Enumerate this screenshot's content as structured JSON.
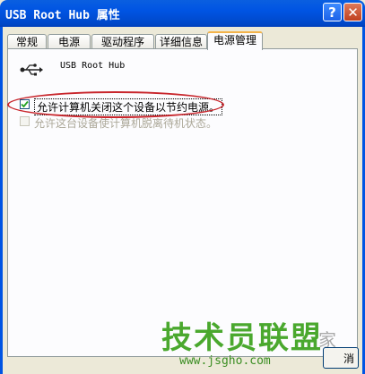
{
  "window": {
    "title": "USB Root Hub 属性"
  },
  "title_buttons": {
    "help": "?",
    "close": "✕"
  },
  "tabs": [
    {
      "label": "常规"
    },
    {
      "label": "电源"
    },
    {
      "label": "驱动程序"
    },
    {
      "label": "详细信息"
    },
    {
      "label": "电源管理"
    }
  ],
  "device": {
    "name": "USB Root Hub",
    "icon": "usb-icon"
  },
  "options": [
    {
      "label": "允许计算机关闭这个设备以节约电源。",
      "checked": true,
      "enabled": true
    },
    {
      "label": "允许这台设备使计算机脱离待机状态。",
      "checked": false,
      "enabled": false
    }
  ],
  "watermark": {
    "text": "技术员联盟",
    "url": "www.jsgho.com",
    "extra": "家"
  },
  "button_fragment": {
    "label": "消"
  },
  "colors": {
    "titlebar": "#0054e3",
    "highlight_ellipse": "#c8262c",
    "watermark": "#4aa82e"
  }
}
